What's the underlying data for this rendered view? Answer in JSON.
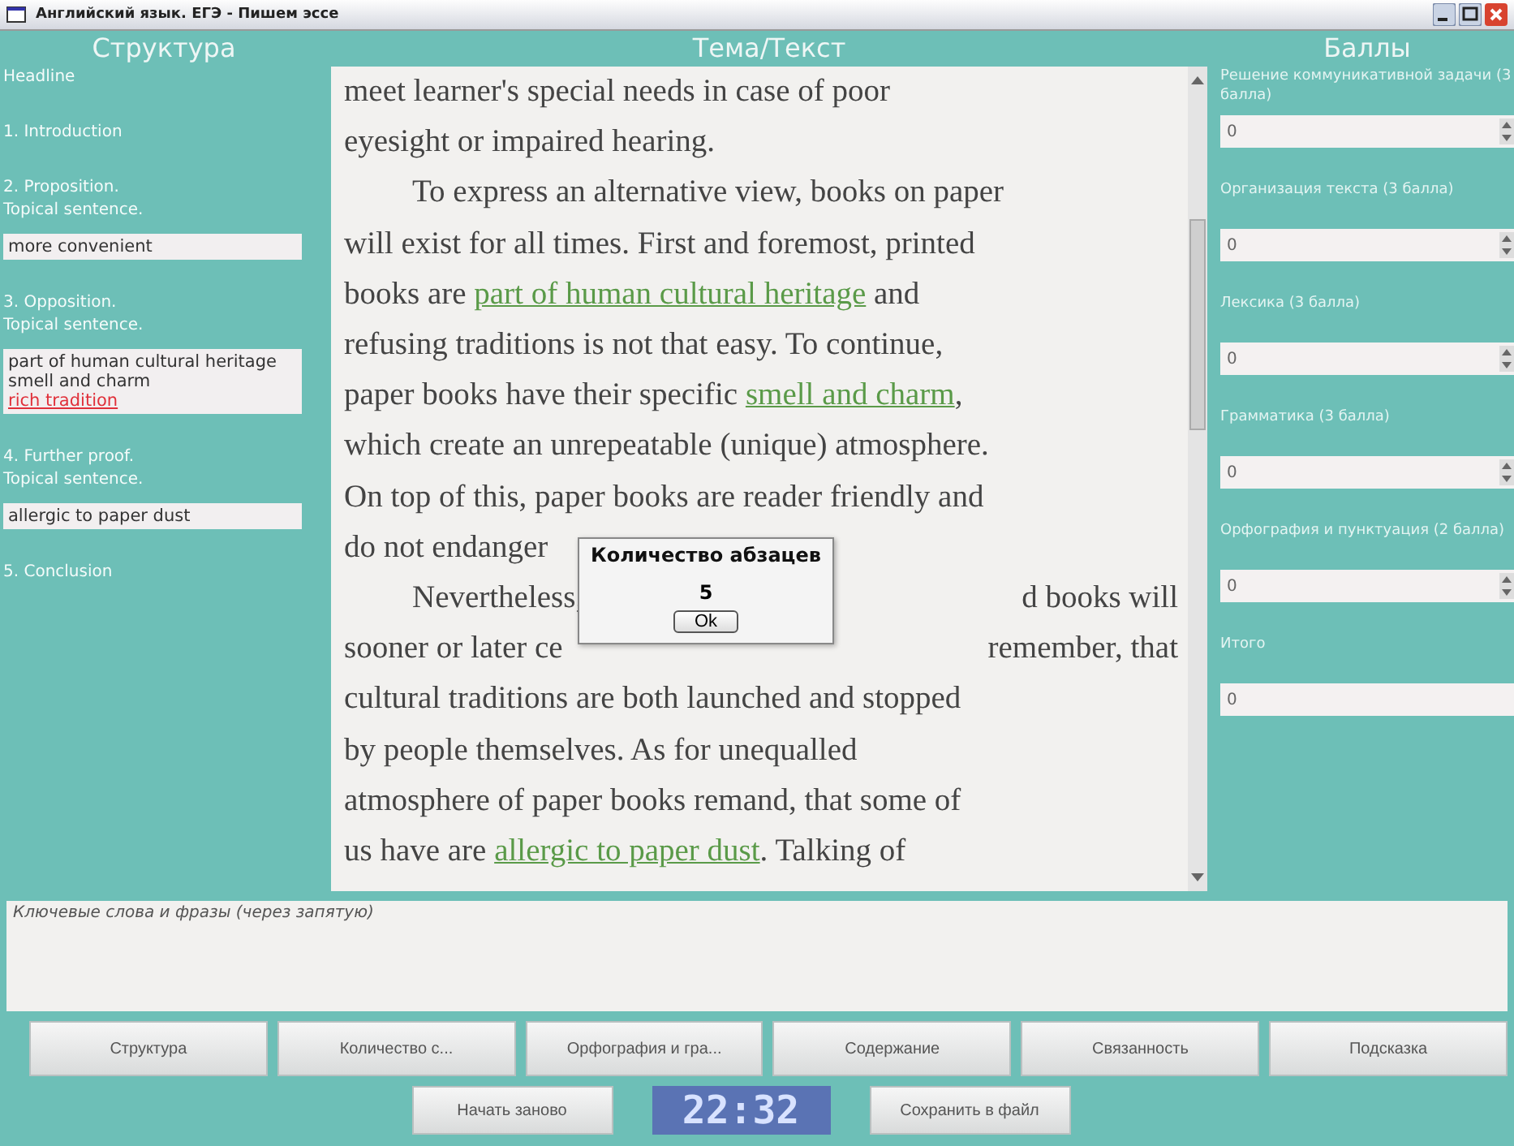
{
  "window": {
    "title": "Английский язык. ЕГЭ - Пишем эссе"
  },
  "structure": {
    "heading": "Структура",
    "items": [
      {
        "label": "Headline"
      },
      {
        "label": "1. Introduction"
      },
      {
        "label": "2. Proposition.\nTopical sentence.",
        "phrases": [
          {
            "text": "more convenient",
            "found": true
          }
        ]
      },
      {
        "label": "3. Opposition.\nTopical sentence.",
        "phrases": [
          {
            "text": "part of human cultural heritage",
            "found": true
          },
          {
            "text": "smell and charm",
            "found": true
          },
          {
            "text": "rich tradition",
            "found": false
          }
        ]
      },
      {
        "label": "4. Further proof.\nTopical sentence.",
        "phrases": [
          {
            "text": "allergic to paper dust",
            "found": true
          }
        ]
      },
      {
        "label": "5. Conclusion"
      }
    ]
  },
  "text_panel": {
    "heading": "Тема/Текст",
    "lines": [
      {
        "indent": false,
        "left": [
          {
            "text": "meet learner's special needs in case of poor",
            "keyword": false
          }
        ]
      },
      {
        "indent": false,
        "left": [
          {
            "text": "eyesight or impaired hearing.",
            "keyword": false
          }
        ]
      },
      {
        "indent": true,
        "left": [
          {
            "text": "To express an alternative view, books on paper",
            "keyword": false
          }
        ]
      },
      {
        "indent": false,
        "left": [
          {
            "text": "will exist for all times. First and foremost, printed",
            "keyword": false
          }
        ]
      },
      {
        "indent": false,
        "left": [
          {
            "text": "books are ",
            "keyword": false
          },
          {
            "text": "part of human cultural heritage",
            "keyword": true
          },
          {
            "text": " and",
            "keyword": false
          }
        ]
      },
      {
        "indent": false,
        "left": [
          {
            "text": "refusing traditions is not that easy. To continue,",
            "keyword": false
          }
        ]
      },
      {
        "indent": false,
        "left": [
          {
            "text": "paper books have their specific ",
            "keyword": false
          },
          {
            "text": "smell and charm",
            "keyword": true
          },
          {
            "text": ",",
            "keyword": false
          }
        ]
      },
      {
        "indent": false,
        "left": [
          {
            "text": "which create an unrepeatable (unique) atmosphere.",
            "keyword": false
          }
        ]
      },
      {
        "indent": false,
        "left": [
          {
            "text": "On top of this, paper books are reader friendly and",
            "keyword": false
          }
        ]
      },
      {
        "indent": false,
        "left": [
          {
            "text": "do not endanger",
            "keyword": false
          }
        ]
      },
      {
        "indent": true,
        "left": [
          {
            "text": "Nevertheless,",
            "keyword": false
          }
        ],
        "right": [
          {
            "text": "d books will",
            "keyword": false
          }
        ]
      },
      {
        "indent": false,
        "left": [
          {
            "text": "sooner or later ce",
            "keyword": false
          }
        ],
        "right": [
          {
            "text": "remember, that",
            "keyword": false
          }
        ]
      },
      {
        "indent": false,
        "left": [
          {
            "text": "cultural traditions are both launched and stopped",
            "keyword": false
          }
        ]
      },
      {
        "indent": false,
        "left": [
          {
            "text": "by people themselves. As for unequalled",
            "keyword": false
          }
        ]
      },
      {
        "indent": false,
        "left": [
          {
            "text": "atmosphere of paper books remand, that some of",
            "keyword": false
          }
        ]
      },
      {
        "indent": false,
        "left": [
          {
            "text": "us have are ",
            "keyword": false
          },
          {
            "text": "allergic to paper dust",
            "keyword": true
          },
          {
            "text": ". Talking of",
            "keyword": false
          }
        ]
      }
    ]
  },
  "dialog": {
    "title": "Количество абзацев",
    "message": "5",
    "button": "Ok"
  },
  "scores": {
    "heading": "Баллы",
    "fields": [
      {
        "label": "Решение коммуникативной задачи (3 балла)",
        "value": "0",
        "spinner": true
      },
      {
        "label": "Организация текста (3 балла)",
        "value": "0",
        "spinner": true
      },
      {
        "label": "Лексика (3 балла)",
        "value": "0",
        "spinner": true
      },
      {
        "label": "Грамматика (3 балла)",
        "value": "0",
        "spinner": true
      },
      {
        "label": "Орфография и пунктуация (2 балла)",
        "value": "0",
        "spinner": true
      },
      {
        "label": "Итого",
        "value": "0",
        "spinner": false
      }
    ]
  },
  "keywords_field": {
    "placeholder": "Ключевые слова и фразы (через запятую)"
  },
  "check_buttons": [
    "Структура",
    "Количество с...",
    "Орфография и гра...",
    "Содержание",
    "Связанность",
    "Подсказка"
  ],
  "bottom_bar": {
    "restart_button": "Начать заново",
    "clock": "22:32",
    "save_button": "Сохранить в файл"
  }
}
